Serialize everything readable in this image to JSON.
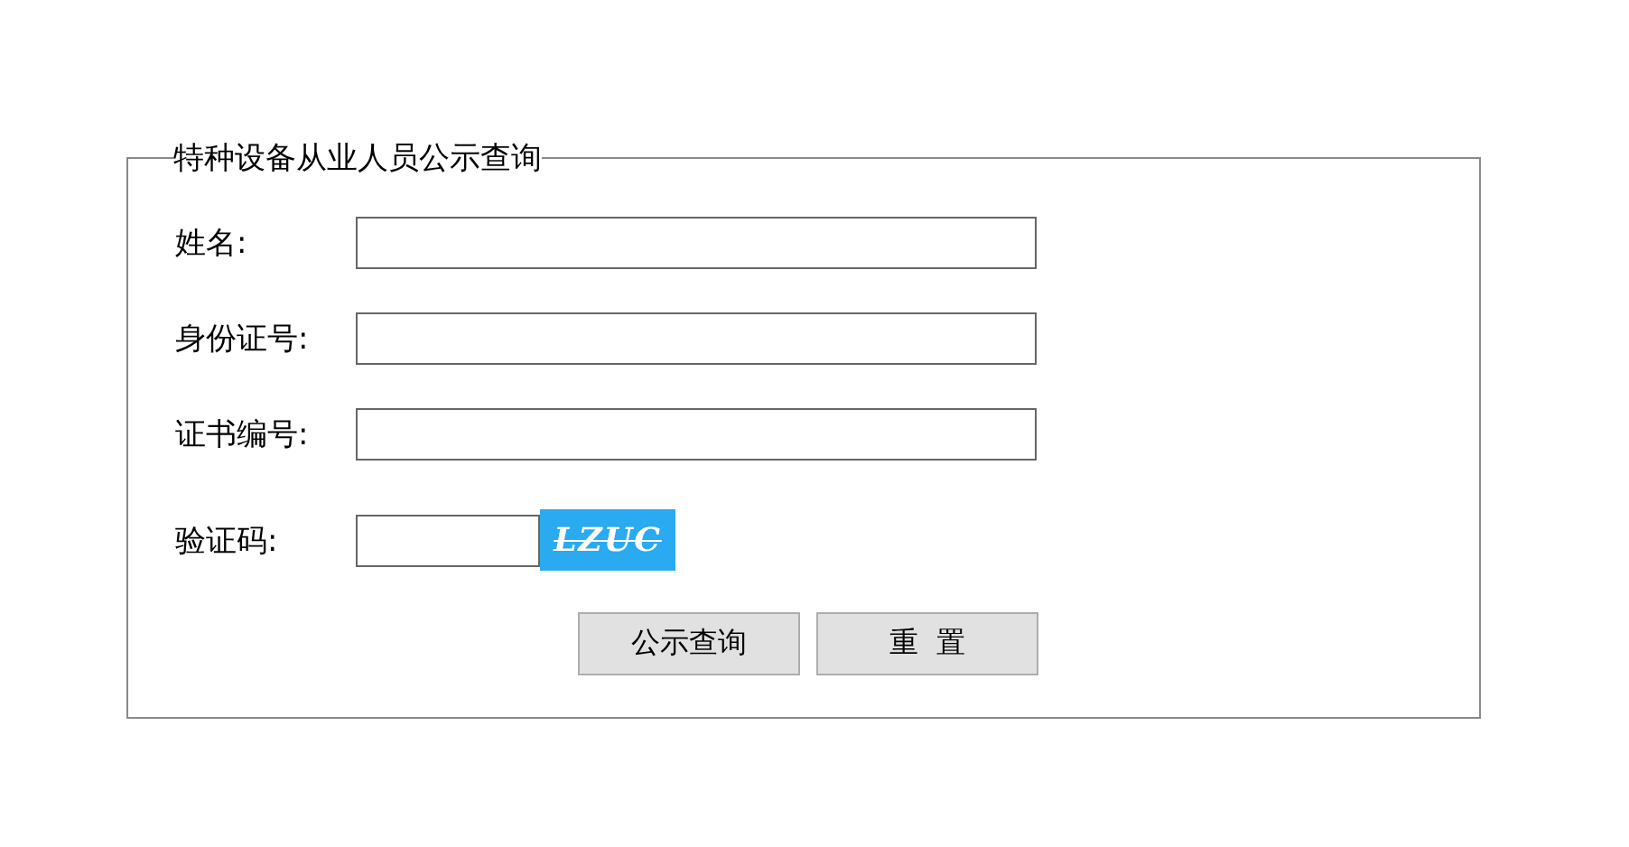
{
  "form": {
    "title": "特种设备从业人员公示查询",
    "fields": [
      {
        "label": "姓名:"
      },
      {
        "label": "身份证号:"
      },
      {
        "label": "证书编号:"
      }
    ],
    "captcha": {
      "label": "验证码:",
      "code": "LZUC"
    },
    "buttons": [
      "公示查询",
      "重  置"
    ]
  }
}
